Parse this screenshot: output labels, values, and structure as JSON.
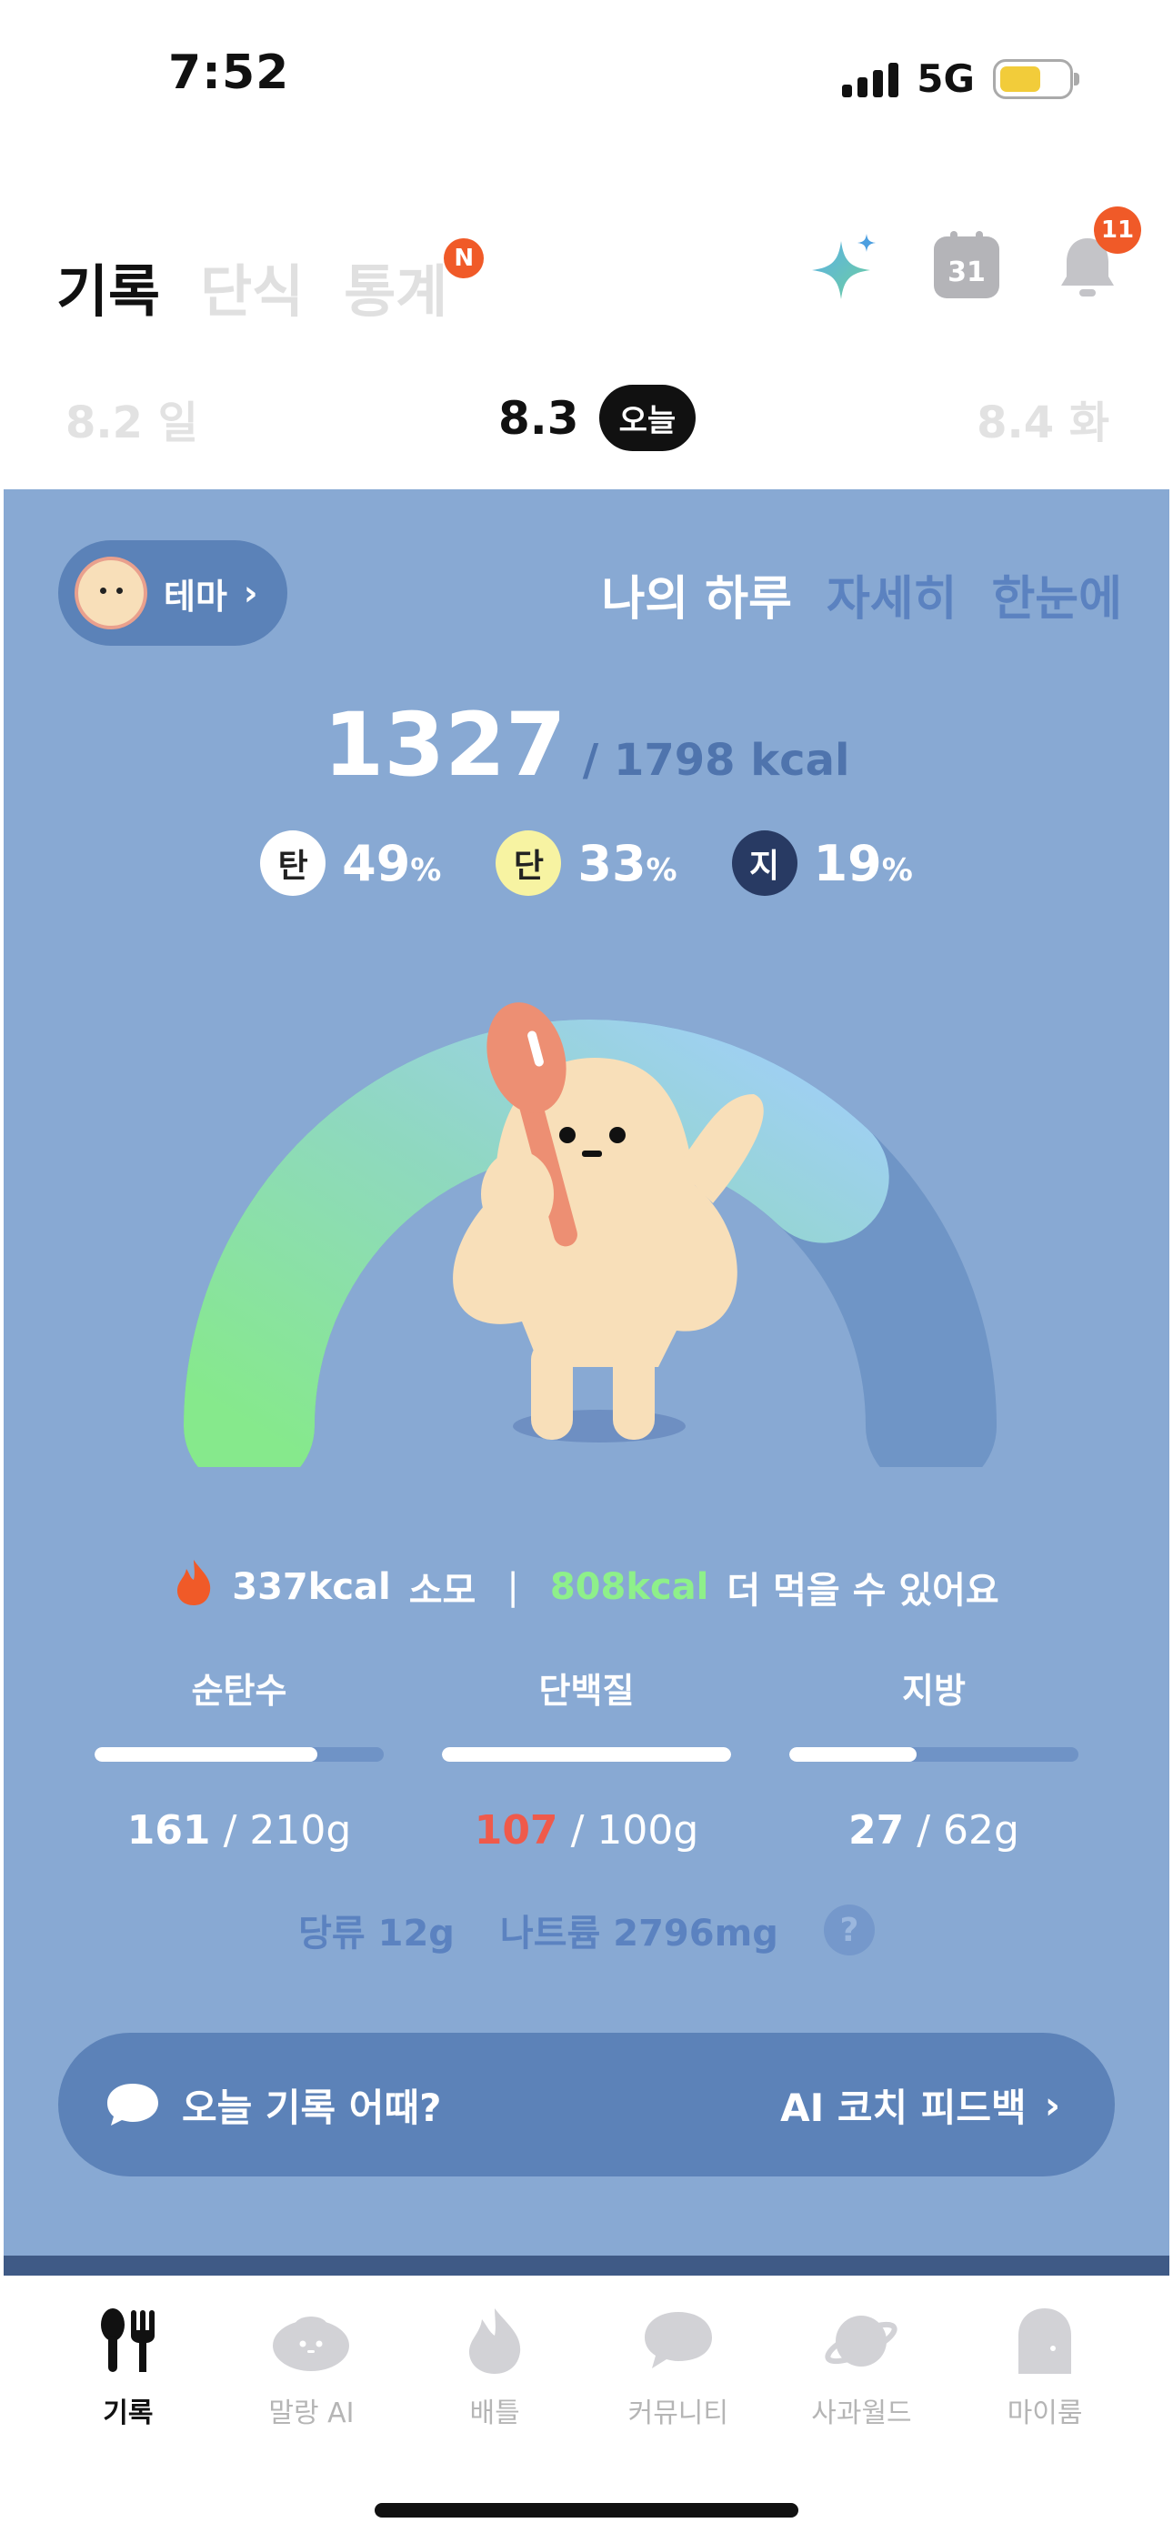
{
  "status_bar": {
    "time": "7:52",
    "network": "5G"
  },
  "header": {
    "tabs": [
      {
        "label": "기록",
        "active": true
      },
      {
        "label": "단식",
        "active": false
      },
      {
        "label": "통계",
        "active": false,
        "badge": "N"
      }
    ],
    "calendar_day": "31",
    "notification_count": "11"
  },
  "dates": {
    "prev": "8.2 일",
    "current": "8.3",
    "today_label": "오늘",
    "next": "8.4 화"
  },
  "panel": {
    "theme_label": "테마",
    "view_tabs": [
      {
        "label": "나의 하루",
        "active": true
      },
      {
        "label": "자세히",
        "active": false
      },
      {
        "label": "한눈에",
        "active": false
      }
    ],
    "kcal_eaten": "1327",
    "kcal_goal": "/ 1798 kcal",
    "macro_percent": [
      {
        "badge": "탄",
        "value": "49",
        "unit": "%",
        "color": "#ffffff"
      },
      {
        "badge": "단",
        "value": "33",
        "unit": "%",
        "color": "#f7f3a2"
      },
      {
        "badge": "지",
        "value": "19",
        "unit": "%",
        "color": "#283a63"
      }
    ],
    "gauge_progress": 0.74,
    "burn": {
      "kcal": "337kcal",
      "burn_text": "소모",
      "remain_kcal": "808kcal",
      "remain_text": "더 먹을 수 있어요"
    },
    "nutrients": [
      {
        "label": "순탄수",
        "current": "161",
        "goal": "/ 210g",
        "progress": 0.77,
        "over": false
      },
      {
        "label": "단백질",
        "current": "107",
        "goal": "/ 100g",
        "progress": 1.0,
        "over": true
      },
      {
        "label": "지방",
        "current": "27",
        "goal": "/ 62g",
        "progress": 0.44,
        "over": false
      }
    ],
    "extras": {
      "sugar": "당류 12g",
      "sodium": "나트륨 2796mg",
      "help": "?"
    },
    "coach": {
      "question": "오늘 기록 어때?",
      "action": "AI 코치 피드백"
    }
  },
  "tabbar": [
    {
      "label": "기록",
      "icon": "utensils-icon",
      "active": true
    },
    {
      "label": "말랑 AI",
      "icon": "malang-ai-icon",
      "active": false
    },
    {
      "label": "배틀",
      "icon": "flame-icon",
      "active": false
    },
    {
      "label": "커뮤니티",
      "icon": "chat-bubble-icon",
      "active": false
    },
    {
      "label": "사과월드",
      "icon": "planet-icon",
      "active": false
    },
    {
      "label": "마이룸",
      "icon": "ghost-room-icon",
      "active": false
    }
  ],
  "colors": {
    "panel_bg": "#88a9d3",
    "accent_orange": "#f05a28",
    "remain_green": "#8ef08a",
    "protein_over": "#ef5a4b"
  }
}
